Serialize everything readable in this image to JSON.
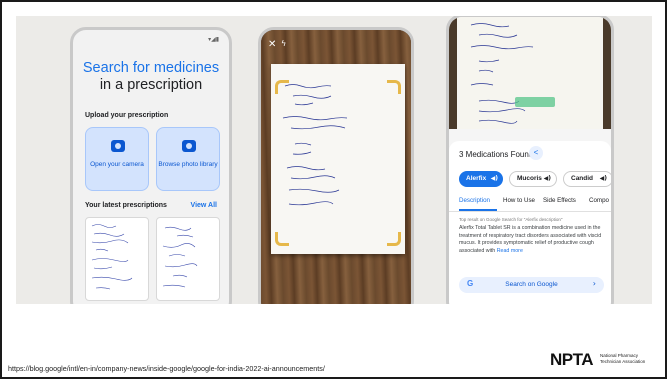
{
  "phone1": {
    "status": "▾◢▮",
    "title_a": "Search ",
    "title_b": "for medicines",
    "title_c": "in a prescription",
    "upload_label": "Upload your prescription",
    "card_camera": "Open your camera",
    "card_library": "Browse photo library",
    "latest_label": "Your latest prescriptions",
    "view_all": "View All"
  },
  "phone2": {
    "close": "✕",
    "flash": "ϟ"
  },
  "phone3": {
    "found": "3 Medications Found",
    "share": "<",
    "chips": [
      "Alerfix",
      "Mucoris",
      "Candid"
    ],
    "tabs": [
      "Description",
      "How to Use",
      "Side Effects",
      "Compo"
    ],
    "source_line": "Top result on Google Search for \"Alerfix description\"",
    "description": "Alerfix Total Tablet SR is a combination medicine used in the treatment of respiratory tract disorders associated with viscid mucus. It provides symptomatic relief of productive cough associated with ",
    "read_more": "Read more",
    "search_g": "G",
    "search_label": "Search on Google",
    "search_arrow": "›"
  },
  "footer": {
    "source_url": "https://blog.google/intl/en-in/company-news/inside-google/google-for-india-2022-ai-announcements/",
    "logo_mark": "NPTA",
    "logo_sub": "National Pharmacy Technician Association"
  }
}
